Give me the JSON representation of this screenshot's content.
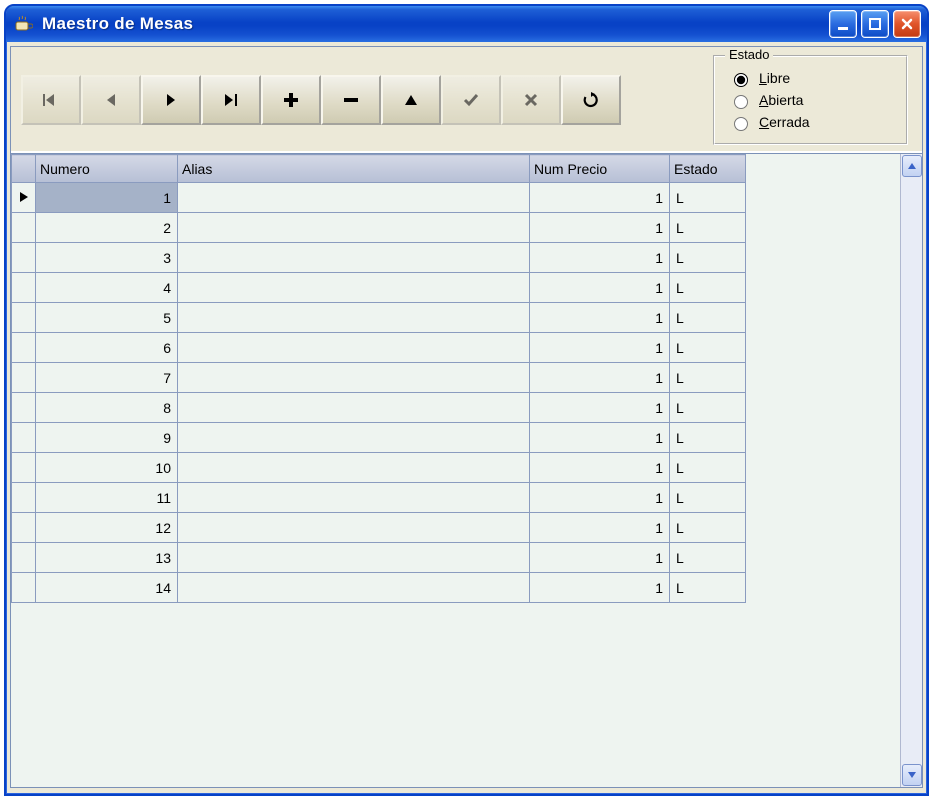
{
  "window": {
    "title": "Maestro de Mesas"
  },
  "toolbar": {
    "icons": {
      "first": "first-icon",
      "prev": "prev-icon",
      "next": "next-icon",
      "last": "last-icon",
      "add": "add-icon",
      "remove": "remove-icon",
      "edit": "edit-icon",
      "confirm": "confirm-icon",
      "cancel": "cancel-icon",
      "refresh": "refresh-icon"
    },
    "states": {
      "first": "disabled",
      "prev": "disabled",
      "next": "enabled",
      "last": "enabled",
      "add": "enabled",
      "remove": "enabled",
      "edit": "enabled",
      "confirm": "disabled",
      "cancel": "disabled",
      "refresh": "enabled"
    }
  },
  "estado": {
    "legend": "Estado",
    "options": [
      {
        "key": "L",
        "label": "Libre",
        "hotkey": "L",
        "checked": true
      },
      {
        "key": "A",
        "label": "Abierta",
        "hotkey": "A",
        "checked": false
      },
      {
        "key": "C",
        "label": "Cerrada",
        "hotkey": "C",
        "checked": false
      }
    ]
  },
  "grid": {
    "columns": [
      {
        "key": "numero",
        "label": "Numero"
      },
      {
        "key": "alias",
        "label": "Alias"
      },
      {
        "key": "num_precio",
        "label": "Num Precio"
      },
      {
        "key": "estado",
        "label": "Estado"
      }
    ],
    "selected_row": 0,
    "rows": [
      {
        "numero": 1,
        "alias": "",
        "num_precio": 1,
        "estado": "L"
      },
      {
        "numero": 2,
        "alias": "",
        "num_precio": 1,
        "estado": "L"
      },
      {
        "numero": 3,
        "alias": "",
        "num_precio": 1,
        "estado": "L"
      },
      {
        "numero": 4,
        "alias": "",
        "num_precio": 1,
        "estado": "L"
      },
      {
        "numero": 5,
        "alias": "",
        "num_precio": 1,
        "estado": "L"
      },
      {
        "numero": 6,
        "alias": "",
        "num_precio": 1,
        "estado": "L"
      },
      {
        "numero": 7,
        "alias": "",
        "num_precio": 1,
        "estado": "L"
      },
      {
        "numero": 8,
        "alias": "",
        "num_precio": 1,
        "estado": "L"
      },
      {
        "numero": 9,
        "alias": "",
        "num_precio": 1,
        "estado": "L"
      },
      {
        "numero": 10,
        "alias": "",
        "num_precio": 1,
        "estado": "L"
      },
      {
        "numero": 11,
        "alias": "",
        "num_precio": 1,
        "estado": "L"
      },
      {
        "numero": 12,
        "alias": "",
        "num_precio": 1,
        "estado": "L"
      },
      {
        "numero": 13,
        "alias": "",
        "num_precio": 1,
        "estado": "L"
      },
      {
        "numero": 14,
        "alias": "",
        "num_precio": 1,
        "estado": "L"
      }
    ]
  }
}
